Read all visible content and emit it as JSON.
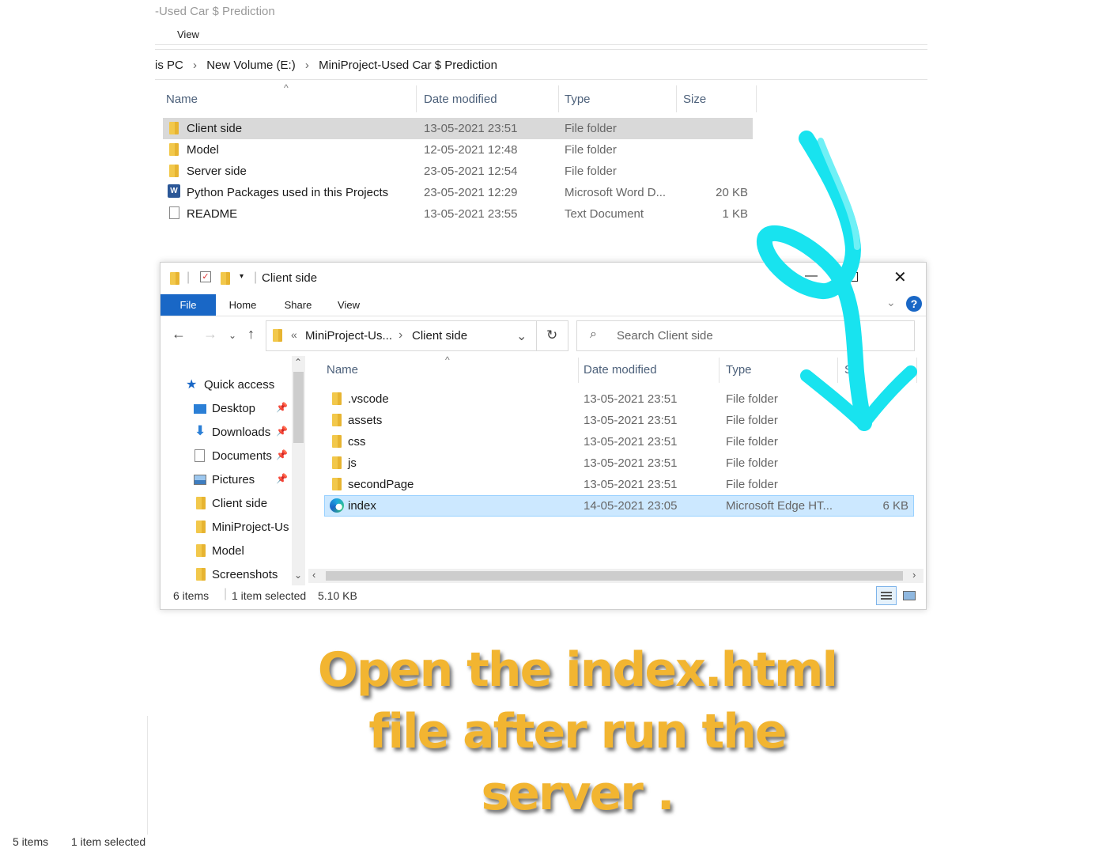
{
  "background_window": {
    "title": "-Used Car $ Prediction",
    "menu_view": "View",
    "breadcrumb": [
      "is PC",
      "New Volume (E:)",
      "MiniProject-Used Car $ Prediction"
    ],
    "columns": [
      "Name",
      "Date modified",
      "Type",
      "Size"
    ],
    "rows": [
      {
        "name": "Client side",
        "date": "13-05-2021 23:51",
        "type": "File folder",
        "size": "",
        "icon": "folder-icon"
      },
      {
        "name": "Model",
        "date": "12-05-2021 12:48",
        "type": "File folder",
        "size": "",
        "icon": "folder-icon"
      },
      {
        "name": "Server side",
        "date": "23-05-2021 12:54",
        "type": "File folder",
        "size": "",
        "icon": "folder-icon"
      },
      {
        "name": "Python Packages used in this Projects",
        "date": "23-05-2021 12:29",
        "type": "Microsoft Word D...",
        "size": "20 KB",
        "icon": "word-document-icon"
      },
      {
        "name": "README",
        "date": "13-05-2021 23:55",
        "type": "Text Document",
        "size": "1 KB",
        "icon": "text-document-icon"
      }
    ],
    "status_items": "5 items",
    "status_selected": "1 item selected"
  },
  "window": {
    "title": "Client side",
    "tabs": [
      "File",
      "Home",
      "Share",
      "View"
    ],
    "address": {
      "prefix": "«",
      "parent": "MiniProject-Us...",
      "current": "Client side"
    },
    "search_placeholder": "Search Client side",
    "nav": {
      "quick_access": "Quick access",
      "items": [
        {
          "label": "Desktop",
          "icon": "desktop-icon",
          "pinned": true
        },
        {
          "label": "Downloads",
          "icon": "downloads-icon",
          "pinned": true
        },
        {
          "label": "Documents",
          "icon": "documents-icon",
          "pinned": true
        },
        {
          "label": "Pictures",
          "icon": "pictures-icon",
          "pinned": true
        },
        {
          "label": "Client side",
          "icon": "folder-icon",
          "pinned": false
        },
        {
          "label": "MiniProject-Us",
          "icon": "folder-icon",
          "pinned": false
        },
        {
          "label": "Model",
          "icon": "folder-icon",
          "pinned": false
        },
        {
          "label": "Screenshots",
          "icon": "folder-icon",
          "pinned": false
        }
      ]
    },
    "columns": [
      "Name",
      "Date modified",
      "Type",
      "S"
    ],
    "files": [
      {
        "name": ".vscode",
        "date": "13-05-2021 23:51",
        "type": "File folder",
        "size": "",
        "icon": "folder-icon"
      },
      {
        "name": "assets",
        "date": "13-05-2021 23:51",
        "type": "File folder",
        "size": "",
        "icon": "folder-icon"
      },
      {
        "name": "css",
        "date": "13-05-2021 23:51",
        "type": "File folder",
        "size": "",
        "icon": "folder-icon"
      },
      {
        "name": "js",
        "date": "13-05-2021 23:51",
        "type": "File folder",
        "size": "",
        "icon": "folder-icon"
      },
      {
        "name": "secondPage",
        "date": "13-05-2021 23:51",
        "type": "File folder",
        "size": "",
        "icon": "folder-icon"
      },
      {
        "name": "index",
        "date": "14-05-2021 23:05",
        "type": "Microsoft Edge HT...",
        "size": "6 KB",
        "icon": "edge-icon",
        "selected": true
      }
    ],
    "status": {
      "items": "6 items",
      "selected": "1 item selected",
      "size": "5.10 KB"
    }
  },
  "caption": [
    "Open the index.html",
    "file after run the",
    "server ."
  ],
  "colors": {
    "accent": "#1967c6",
    "selection": "#cce8ff",
    "arrow": "#18e3ef",
    "caption": "#f2b531"
  }
}
